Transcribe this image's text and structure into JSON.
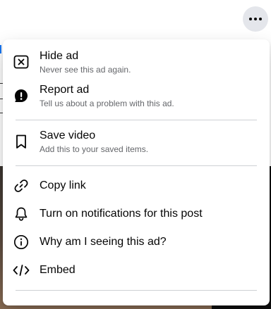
{
  "colors": {
    "primary_text": "#050505",
    "secondary_text": "#65676b",
    "divider": "#ced0d4",
    "button_bg": "#e4e6eb"
  },
  "more_button": {
    "icon": "more-horizontal-icon"
  },
  "menu": {
    "groups": [
      [
        {
          "icon": "hide-ad-icon",
          "title": "Hide ad",
          "desc": "Never see this ad again."
        },
        {
          "icon": "report-icon",
          "title": "Report ad",
          "desc": "Tell us about a problem with this ad."
        }
      ],
      [
        {
          "icon": "bookmark-icon",
          "title": "Save video",
          "desc": "Add this to your saved items."
        }
      ],
      [
        {
          "icon": "link-icon",
          "title": "Copy link"
        },
        {
          "icon": "bell-icon",
          "title": "Turn on notifications for this post"
        },
        {
          "icon": "info-icon",
          "title": "Why am I seeing this ad?"
        },
        {
          "icon": "embed-icon",
          "title": "Embed"
        }
      ]
    ]
  }
}
